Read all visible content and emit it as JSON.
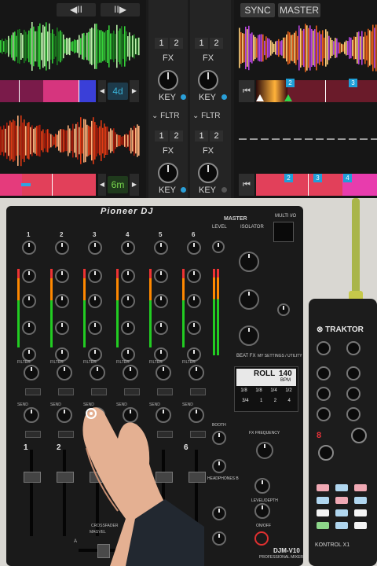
{
  "software": {
    "deck_top_right": {
      "sync_label": "SYNC",
      "master_label": "MASTER"
    },
    "nav_left": {
      "back_label": "◀II",
      "fwd_label": "II▶"
    },
    "loop_badges": [
      {
        "value": "4d",
        "color": "#3ab3d8"
      },
      {
        "value": "6m",
        "color": "#7ad94e"
      }
    ],
    "fx_units": [
      {
        "btn1": "1",
        "btn2": "2",
        "fx_label": "FX",
        "key_label": "KEY",
        "led": "on"
      },
      {
        "btn1": "1",
        "btn2": "2",
        "fx_label": "FX",
        "key_label": "KEY",
        "led": "on"
      },
      {
        "btn1": "1",
        "btn2": "2",
        "fx_label": "FX",
        "key_label": "KEY",
        "led": "on"
      },
      {
        "btn1": "1",
        "btn2": "2",
        "fx_label": "FX",
        "key_label": "KEY",
        "led": "off"
      }
    ],
    "filter_labels": [
      "FLTR",
      "FLTR"
    ],
    "cue_markers_top": [
      "2",
      "3"
    ],
    "cue_markers_bottom": [
      "2",
      "3",
      "4"
    ],
    "waveform_colors": {
      "deck_a": "#36d23a",
      "deck_b": "#e03a14",
      "deck_c": "#e8611a",
      "deck_c_alt": "#b845e0",
      "strip_pink": "#e8358a",
      "strip_blue": "#3a4fe0"
    }
  },
  "mixer": {
    "brand": "Pioneer DJ",
    "master_label": "MASTER",
    "level_label": "LEVEL",
    "isolator_label": "ISOLATOR",
    "multi_io_label": "MULTI I/O",
    "beat_fx_label": "BEAT FX",
    "utility_label": "MY SETTINGS / UTILITY",
    "fx_frequency_label": "FX FREQUENCY",
    "booth_label": "BOOTH",
    "headphones_label": "HEADPHONES B",
    "model": "DJM-V10",
    "model_sub": "PROFESSIONAL MIXER",
    "level_depth_label": "LEVEL/DEPTH",
    "on_off_label": "ON/OFF",
    "channel_numbers": [
      "1",
      "2",
      "3",
      "4",
      "5",
      "6"
    ],
    "channel_labels": [
      "1",
      "2",
      "3",
      "4",
      "5",
      "6"
    ],
    "filter_label": "FILTER",
    "send_label": "SEND",
    "crossfader_label": "CROSSFADER",
    "crossfader_sub": "MAGVEL",
    "crossfader_a": "A",
    "screen": {
      "bpm": "140",
      "bpm_unit": "BPM",
      "effect": "ROLL",
      "beats": [
        "1/8",
        "1/8",
        "1/4",
        "1/2"
      ],
      "row3": [
        "3/4",
        "1",
        "2",
        "4"
      ]
    }
  },
  "controller": {
    "brand": "TRAKTOR",
    "model": "KONTROL X1",
    "display_digit": "8",
    "pad_colors": [
      "#f0a9b4",
      "#b0d6ef",
      "#f0a9b4",
      "#b0d6ef",
      "#f0a9b4",
      "#b0d6ef",
      "#f4f4f4",
      "#b0d6ef",
      "#f4f4f4",
      "#8dd68a",
      "#b0d6ef",
      "#f4f4f4"
    ]
  }
}
